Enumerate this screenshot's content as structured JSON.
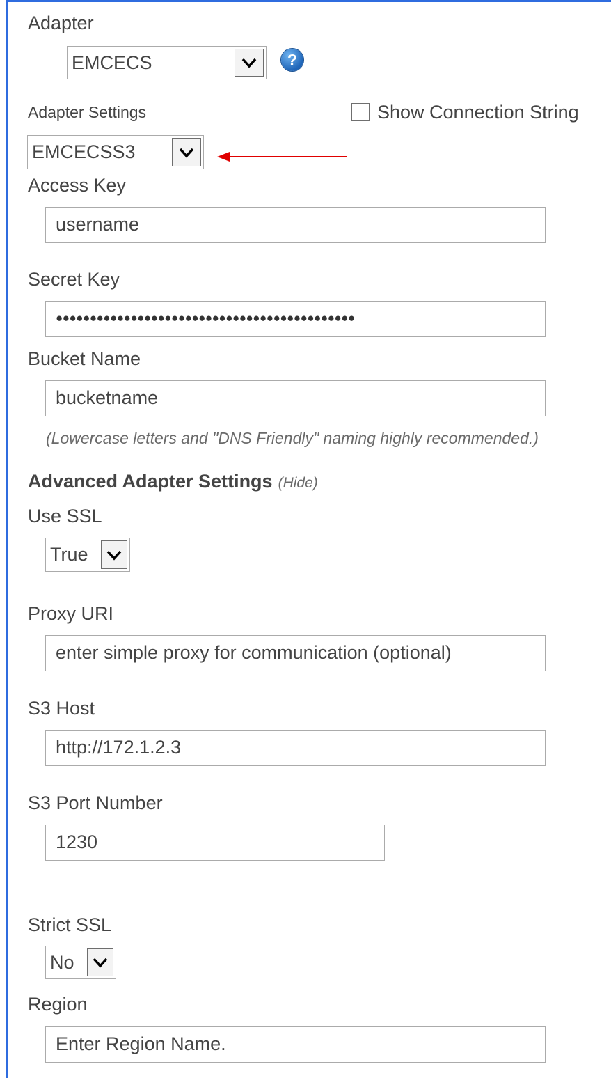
{
  "theme": {
    "frame_color": "#2f6cdf",
    "arrow_color": "#e00000",
    "help_color": "#1f65b8"
  },
  "adapter": {
    "label": "Adapter",
    "selected": "EMCECS",
    "help_glyph": "?",
    "help_icon": "question-circle-icon"
  },
  "adapter_settings": {
    "label": "Adapter Settings",
    "selected": "EMCECSS3",
    "show_connection_string_label": "Show Connection String",
    "show_connection_string_checked": false
  },
  "access_key": {
    "label": "Access Key",
    "value": "username"
  },
  "secret_key": {
    "label": "Secret Key",
    "value": "●●●●●●●●●●●●●●●●●●●●●●●●●●●●●●●●●●●●●●●●●●●●"
  },
  "bucket_name": {
    "label": "Bucket Name",
    "value": "bucketname",
    "hint": "(Lowercase letters and \"DNS Friendly\" naming highly recommended.)"
  },
  "advanced": {
    "title": "Advanced Adapter Settings",
    "toggle": "(Hide)"
  },
  "use_ssl": {
    "label": "Use SSL",
    "selected": "True"
  },
  "proxy_uri": {
    "label": "Proxy URI",
    "placeholder": "enter simple proxy for communication (optional)"
  },
  "s3_host": {
    "label": "S3 Host",
    "value": "http://172.1.2.3"
  },
  "s3_port": {
    "label": "S3 Port Number",
    "value": "1230"
  },
  "strict_ssl": {
    "label": "Strict SSL",
    "selected": "No"
  },
  "region": {
    "label": "Region",
    "placeholder": "Enter Region Name."
  }
}
